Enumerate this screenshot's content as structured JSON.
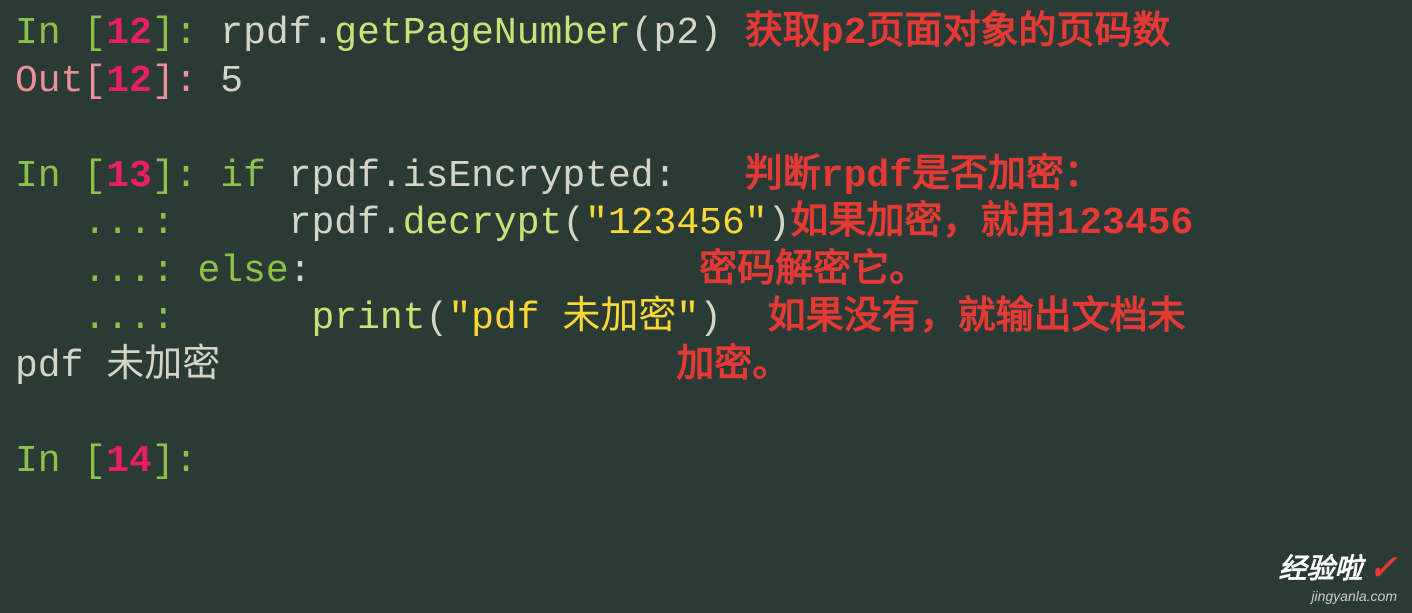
{
  "cells": {
    "c12": {
      "in_label": "In ",
      "in_num": "12",
      "out_label": "Out",
      "out_num": "12",
      "code": "rpdf",
      "dot": ".",
      "fn": "getPageNumber",
      "arg": "(p2)",
      "comment": "获取p2页面对象的页码数",
      "result": "5"
    },
    "c13": {
      "in_label": "In ",
      "in_num": "13",
      "cont": "   ...: ",
      "kw_if": "if",
      "obj": " rpdf",
      "dot1": ".",
      "prop": "isEncrypted",
      "colon1": ":",
      "indent1": "    rpdf",
      "dot2": ".",
      "fn": "decrypt",
      "lp": "(",
      "str": "\"123456\"",
      "rp": ")",
      "kw_else": "else",
      "colon2": ":",
      "indent2": "     ",
      "fn2": "print",
      "lp2": "(",
      "str2": "\"pdf 未加密\"",
      "rp2": ")",
      "output": "pdf 未加密",
      "comment_l1": "判断rpdf是否加密：",
      "comment_l2": "如果加密，就用123456",
      "comment_l3": "密码解密它。",
      "comment_l4": "如果没有，就输出文档未",
      "comment_l5": "加密。"
    },
    "c14": {
      "in_label": "In ",
      "in_num": "14"
    }
  },
  "watermark": {
    "big": "经验啦",
    "small": "jingyanla.com"
  }
}
